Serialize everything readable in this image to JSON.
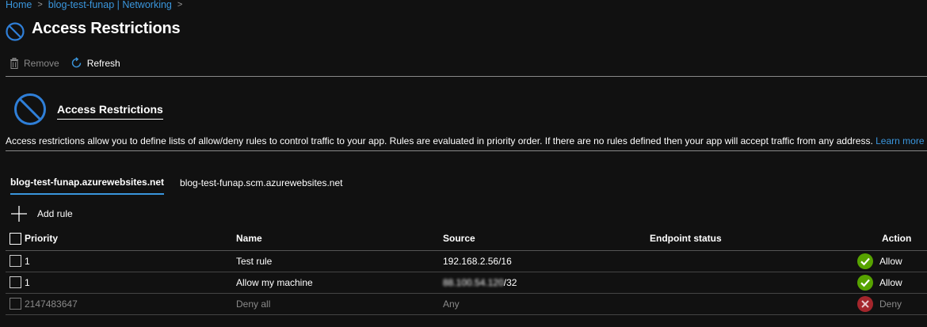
{
  "breadcrumb": {
    "home": "Home",
    "parent": "blog-test-funap | Networking"
  },
  "header": {
    "title": "Access Restrictions"
  },
  "toolbar": {
    "remove_label": "Remove",
    "refresh_label": "Refresh"
  },
  "section": {
    "title": "Access Restrictions",
    "description": "Access restrictions allow you to define lists of allow/deny rules to control traffic to your app. Rules are evaluated in priority order. If there are no rules defined then your app will accept traffic from any address.",
    "learn_more": "Learn more"
  },
  "tabs": [
    {
      "label": "blog-test-funap.azurewebsites.net",
      "active": true
    },
    {
      "label": "blog-test-funap.scm.azurewebsites.net",
      "active": false
    }
  ],
  "add_rule_label": "Add rule",
  "table": {
    "headers": {
      "priority": "Priority",
      "name": "Name",
      "source": "Source",
      "endpoint": "Endpoint status",
      "action": "Action"
    },
    "rows": [
      {
        "priority": "1",
        "name": "Test rule",
        "source": "192.168.2.56/16",
        "action": "Allow"
      },
      {
        "priority": "1",
        "name": "Allow my machine",
        "source_masked": "88.100.54.120",
        "source_suffix": "/32",
        "action": "Allow"
      },
      {
        "priority": "2147483647",
        "name": "Deny all",
        "source": "Any",
        "action": "Deny"
      }
    ]
  },
  "colors": {
    "accent": "#3a96dd",
    "allow": "#57a300",
    "deny": "#a4262c",
    "background": "#111111"
  },
  "icons": {
    "title": "block-icon",
    "remove": "trash-icon",
    "refresh": "refresh-icon",
    "add": "plus-icon",
    "allow": "check-circle-icon",
    "deny": "x-circle-icon"
  }
}
